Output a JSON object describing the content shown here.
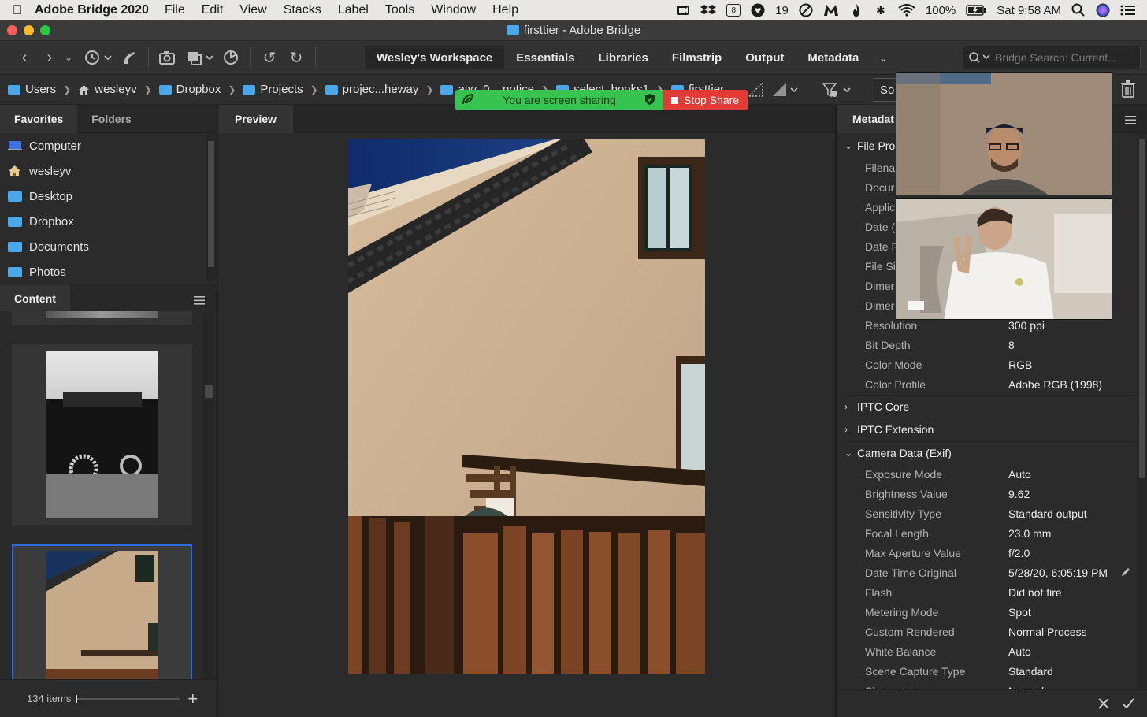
{
  "menubar": {
    "app_name": "Adobe Bridge 2020",
    "menus": [
      "File",
      "Edit",
      "View",
      "Stacks",
      "Label",
      "Tools",
      "Window",
      "Help"
    ],
    "calendar_day": "8",
    "notification_count": "19",
    "battery": "100%",
    "clock": "Sat 9:58 AM"
  },
  "window": {
    "title": "firsttier - Adobe Bridge"
  },
  "toolbar": {
    "workspaces": [
      "Wesley's Workspace",
      "Essentials",
      "Libraries",
      "Filmstrip",
      "Output",
      "Metadata"
    ],
    "search_placeholder": "Bridge Search: Current..."
  },
  "pathbar": {
    "crumbs": [
      "Users",
      "wesleyv",
      "Dropbox",
      "Projects",
      "projec...heway",
      "atw_0",
      "...notice",
      "select_books1",
      "firsttier"
    ],
    "sort_label": "So"
  },
  "share": {
    "status": "You are screen sharing",
    "stop_label": "Stop Share"
  },
  "favorites": {
    "tabs": [
      "Favorites",
      "Folders"
    ],
    "items": [
      "Computer",
      "wesleyv",
      "Desktop",
      "Dropbox",
      "Documents",
      "Photos"
    ]
  },
  "content": {
    "title": "Content",
    "item_count": "134 items"
  },
  "preview": {
    "title": "Preview"
  },
  "metadata": {
    "title": "Metadat",
    "file_props_title": "File Pro",
    "file_props": [
      {
        "k": "Filena",
        "v": ""
      },
      {
        "k": "Docur",
        "v": ""
      },
      {
        "k": "Applic",
        "v": ""
      },
      {
        "k": "Date (",
        "v": ""
      },
      {
        "k": "Date F",
        "v": ""
      },
      {
        "k": "File Si",
        "v": ""
      },
      {
        "k": "Dimer",
        "v": ""
      },
      {
        "k": "Dimer",
        "v": ""
      },
      {
        "k": "Resolution",
        "v": "300 ppi"
      },
      {
        "k": "Bit Depth",
        "v": "8"
      },
      {
        "k": "Color Mode",
        "v": "RGB"
      },
      {
        "k": "Color Profile",
        "v": "Adobe RGB (1998)"
      }
    ],
    "iptc_core": "IPTC Core",
    "iptc_ext": "IPTC Extension",
    "camera_title": "Camera Data (Exif)",
    "camera": [
      {
        "k": "Exposure Mode",
        "v": "Auto"
      },
      {
        "k": "Brightness Value",
        "v": "9.62"
      },
      {
        "k": "Sensitivity Type",
        "v": "Standard output"
      },
      {
        "k": "Focal Length",
        "v": "23.0 mm"
      },
      {
        "k": "Max Aperture Value",
        "v": "f/2.0"
      },
      {
        "k": "Date Time Original",
        "v": "5/28/20, 6:05:19 PM"
      },
      {
        "k": "Flash",
        "v": "Did not fire"
      },
      {
        "k": "Metering Mode",
        "v": "Spot"
      },
      {
        "k": "Custom Rendered",
        "v": "Normal Process"
      },
      {
        "k": "White Balance",
        "v": "Auto"
      },
      {
        "k": "Scene Capture Type",
        "v": "Standard"
      },
      {
        "k": "Sharpness",
        "v": "Normal"
      }
    ]
  },
  "colors": {
    "accent_folder": "#49a7ea",
    "selection": "#2d6cdf",
    "share_green": "#37c34f",
    "share_red": "#e23b36"
  }
}
